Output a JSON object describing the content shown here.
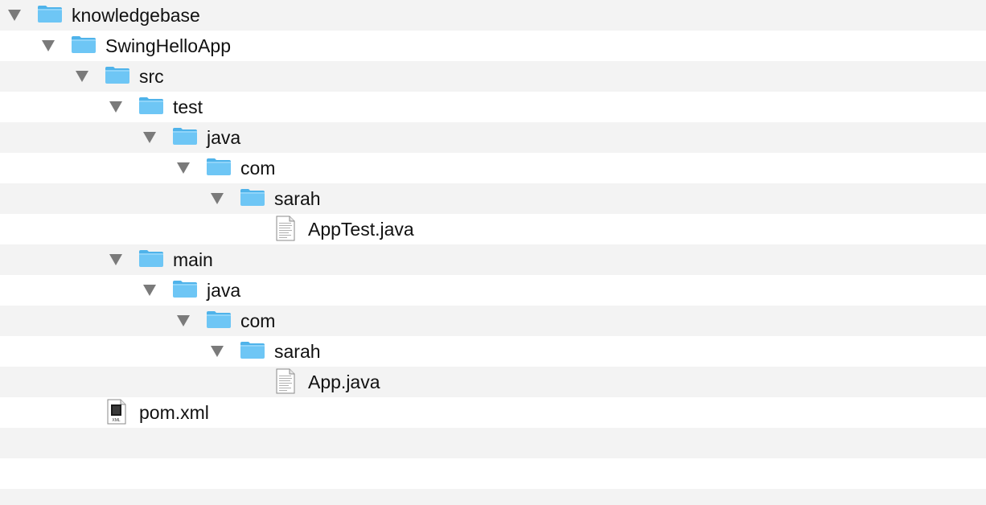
{
  "tree": {
    "rows": [
      {
        "label": "knowledgebase",
        "kind": "folder",
        "icon": "folder-icon",
        "expanded": true
      },
      {
        "label": "SwingHelloApp",
        "kind": "folder",
        "icon": "folder-icon",
        "expanded": true
      },
      {
        "label": "src",
        "kind": "folder",
        "icon": "folder-icon",
        "expanded": true
      },
      {
        "label": "test",
        "kind": "folder",
        "icon": "folder-icon",
        "expanded": true
      },
      {
        "label": "java",
        "kind": "folder",
        "icon": "folder-icon",
        "expanded": true
      },
      {
        "label": "com",
        "kind": "folder",
        "icon": "folder-icon",
        "expanded": true
      },
      {
        "label": "sarah",
        "kind": "folder",
        "icon": "folder-icon",
        "expanded": true
      },
      {
        "label": "AppTest.java",
        "kind": "file",
        "icon": "java-file-icon"
      },
      {
        "label": "main",
        "kind": "folder",
        "icon": "folder-icon",
        "expanded": true
      },
      {
        "label": "java",
        "kind": "folder",
        "icon": "folder-icon",
        "expanded": true
      },
      {
        "label": "com",
        "kind": "folder",
        "icon": "folder-icon",
        "expanded": true
      },
      {
        "label": "sarah",
        "kind": "folder",
        "icon": "folder-icon",
        "expanded": true
      },
      {
        "label": "App.java",
        "kind": "file",
        "icon": "java-file-icon"
      },
      {
        "label": "pom.xml",
        "kind": "file",
        "icon": "xml-file-icon",
        "icon_caption": "XML"
      }
    ]
  },
  "colors": {
    "row_alt": "#f3f3f3",
    "row_plain": "#ffffff",
    "folder_body": "#6ec6f5",
    "folder_tab": "#4fb3ea",
    "disclosure": "#7a7a7a",
    "text": "#111111"
  }
}
